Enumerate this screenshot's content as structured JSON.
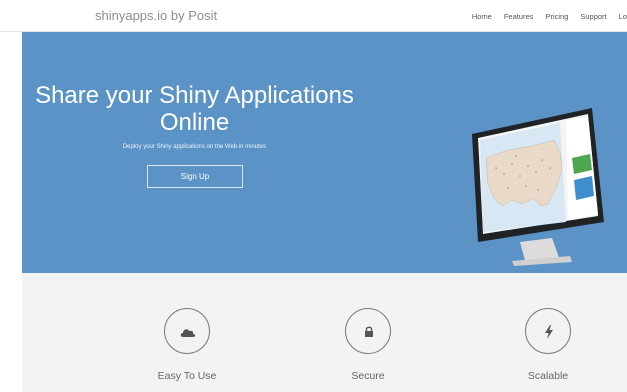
{
  "header": {
    "brand": "shinyapps.io by Posit",
    "nav": [
      "Home",
      "Features",
      "Pricing",
      "Support",
      "Lo"
    ]
  },
  "hero": {
    "headline": "Share your Shiny Applications Online",
    "subline": "Deploy your Shiny applications on the Web in minutes",
    "signup_label": "Sign Up"
  },
  "features": [
    {
      "label": "Easy To Use",
      "icon": "cloud-icon"
    },
    {
      "label": "Secure",
      "icon": "lock-icon"
    },
    {
      "label": "Scalable",
      "icon": "lightning-icon"
    }
  ],
  "colors": {
    "hero_bg": "#5b93c6",
    "features_bg": "#f3f3f6",
    "icon_stroke": "#7d7d7d"
  }
}
